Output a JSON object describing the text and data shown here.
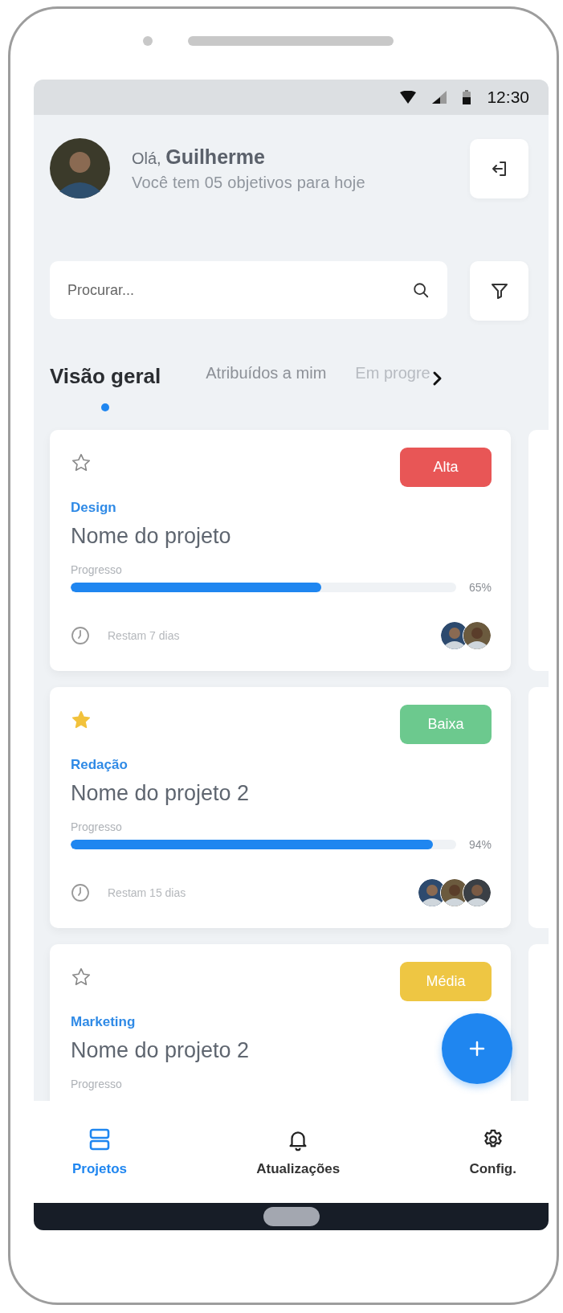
{
  "status_bar": {
    "time": "12:30"
  },
  "header": {
    "avatar": {
      "kind": "picture"
    },
    "greeting": "Olá,",
    "name": "Guilherme",
    "subtitle": "Você tem 05 objetivos para hoje"
  },
  "search": {
    "placeholder": "Procurar..."
  },
  "tabs": [
    {
      "label": "Visão geral",
      "selected": true
    },
    {
      "label": "Atribuídos a mim",
      "selected": false
    },
    {
      "label": "Em progre",
      "selected": false
    }
  ],
  "cards": [
    {
      "starred": false,
      "priority": "Alta",
      "color": "#e85656",
      "category": "Design",
      "title": "Nome do projeto",
      "progress_label": "Progresso",
      "level": 0.65,
      "percent": "65%",
      "remaining": "Restam 7 dias",
      "members": [
        {
          "kind": "picture"
        },
        {
          "kind": "picture"
        }
      ]
    },
    {
      "starred": true,
      "priority": "Baixa",
      "color": "#6cc98e",
      "category": "Redação",
      "title": "Nome do projeto 2",
      "progress_label": "Progresso",
      "level": 0.94,
      "percent": "94%",
      "remaining": "Restam 15 dias",
      "members": [
        {
          "kind": "picture"
        },
        {
          "kind": "picture"
        },
        {
          "kind": "picture"
        }
      ]
    },
    {
      "starred": false,
      "priority": "Média",
      "color": "#eec643",
      "category": "Marketing",
      "title": "Nome do projeto 2",
      "progress_label": "Progresso"
    }
  ],
  "nav": [
    {
      "label": "Projetos",
      "selected": true
    },
    {
      "label": "Atualizações",
      "selected": false
    },
    {
      "label": "Config.",
      "selected": false
    }
  ]
}
